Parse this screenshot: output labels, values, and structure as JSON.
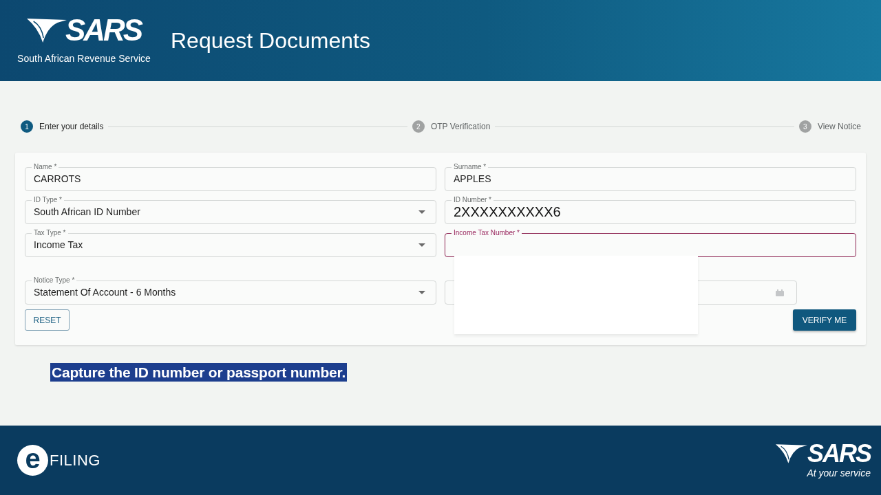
{
  "header": {
    "logo": {
      "wordmark": "SARS",
      "subtitle": "South African Revenue Service"
    },
    "title": "Request Documents"
  },
  "stepper": [
    {
      "number": "1",
      "label": "Enter your details",
      "selected": true
    },
    {
      "number": "2",
      "label": "OTP Verification",
      "selected": false
    },
    {
      "number": "3",
      "label": "View Notice",
      "selected": false
    }
  ],
  "form": {
    "fields": [
      {
        "kind": "text",
        "label": "Name *",
        "value": "CARROTS",
        "focused": false,
        "large": false
      },
      {
        "kind": "text",
        "label": "Surname *",
        "value": "APPLES",
        "focused": false,
        "large": false
      },
      {
        "kind": "select",
        "label": "ID Type *",
        "value": "South African ID Number",
        "focused": false,
        "large": false
      },
      {
        "kind": "text",
        "label": "ID Number *",
        "value": "2XXXXXXXXXX6",
        "focused": false,
        "large": true
      },
      {
        "kind": "select",
        "label": "Tax Type *",
        "value": "Income Tax",
        "focused": false,
        "large": false
      },
      {
        "kind": "text",
        "label": "Income Tax Number *",
        "focused": true
      },
      {
        "kind": "select",
        "label": "Notice Type *",
        "value": "Statement Of Account - 6 Months",
        "focused": false,
        "large": false
      },
      {
        "kind": "date",
        "focused": false
      }
    ],
    "popup": {
      "visible": true
    },
    "buttons": [
      {
        "kind": "outline",
        "label": "RESET"
      },
      {
        "kind": "filled",
        "label": "VERIFY ME"
      }
    ]
  },
  "caption": "Capture the ID number or passport number.",
  "footer": {
    "efiling_logo": {
      "mark": "e",
      "text": "FILING"
    },
    "sars_logo": {
      "wordmark": "SARS",
      "tagline": "At your service"
    }
  }
}
